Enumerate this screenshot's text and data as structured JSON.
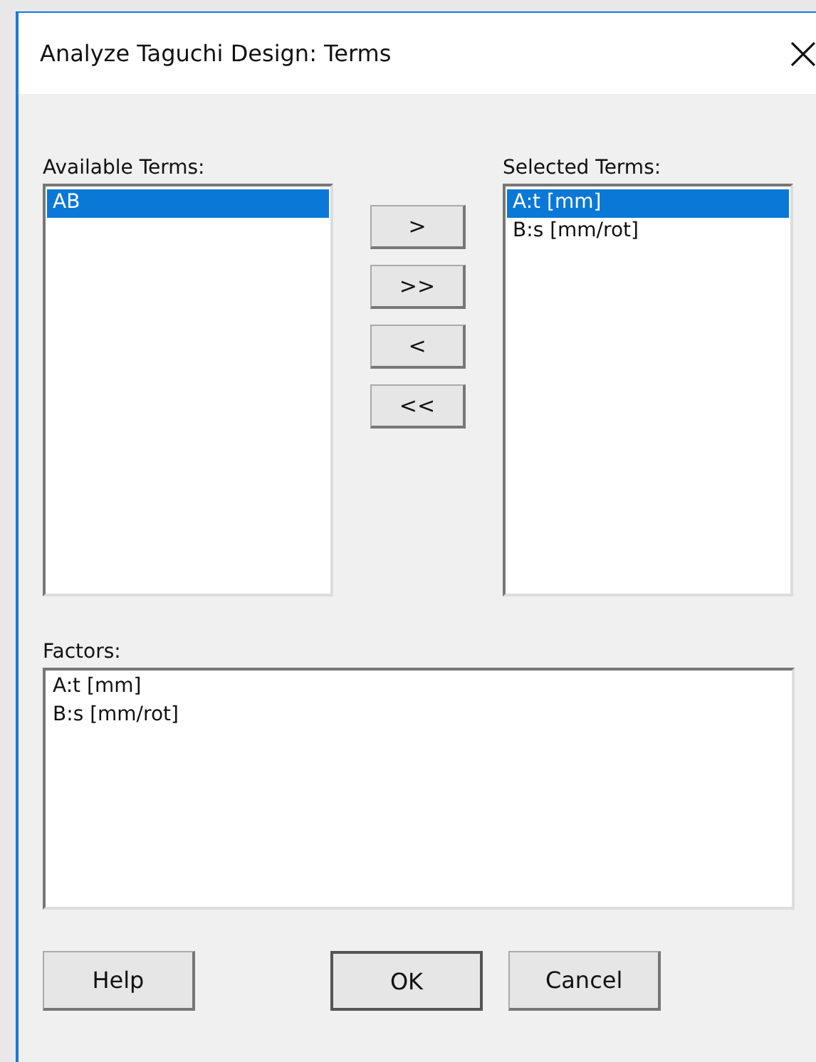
{
  "window": {
    "title": "Analyze Taguchi Design: Terms"
  },
  "available_terms": {
    "label": "Available Terms:",
    "items": [
      {
        "text": "AB",
        "selected": true
      }
    ]
  },
  "move_buttons": [
    {
      "label": ">"
    },
    {
      "label": ">>"
    },
    {
      "label": "<"
    },
    {
      "label": "<<"
    }
  ],
  "selected_terms": {
    "label": "Selected Terms:",
    "items": [
      {
        "text": "A:t [mm]",
        "selected": true
      },
      {
        "text": "B:s [mm/rot]",
        "selected": false
      }
    ]
  },
  "factors": {
    "label": "Factors:",
    "items": [
      {
        "text": "A:t [mm]",
        "selected": false
      },
      {
        "text": "B:s [mm/rot]",
        "selected": false
      }
    ]
  },
  "buttons": [
    {
      "label": "Help",
      "default": false
    },
    {
      "label": "OK",
      "default": true
    },
    {
      "label": "Cancel",
      "default": false
    }
  ]
}
